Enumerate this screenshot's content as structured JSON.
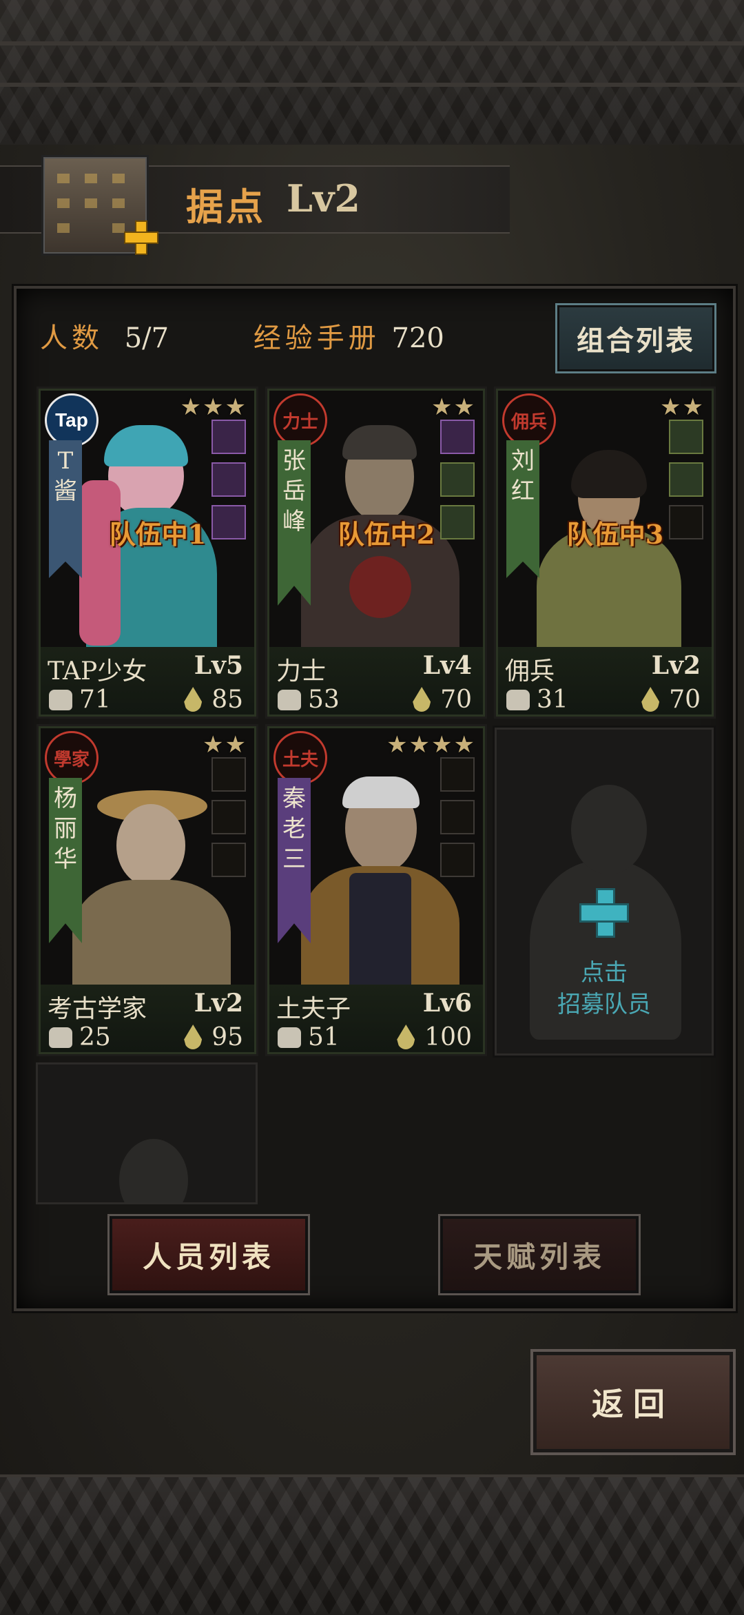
{
  "header": {
    "title": "据点",
    "level": "Lv2"
  },
  "info": {
    "members_label": "人数",
    "members_value": "5/7",
    "exp_label": "经验手册",
    "exp_value": "720"
  },
  "combo_button": "组合列表",
  "cards": [
    {
      "emblem": "Tap",
      "ribbon_name": [
        "T",
        "酱"
      ],
      "stars": "★★★",
      "status": "队伍中1",
      "name": "TAP少女",
      "level": "Lv5",
      "strength": "71",
      "stamina": "85"
    },
    {
      "emblem": "力士",
      "ribbon_name": [
        "张",
        "岳",
        "峰"
      ],
      "stars": "★★",
      "status": "队伍中2",
      "name": "力士",
      "level": "Lv4",
      "strength": "53",
      "stamina": "70"
    },
    {
      "emblem": "佣兵",
      "ribbon_name": [
        "刘",
        "红"
      ],
      "stars": "★★",
      "status": "队伍中3",
      "name": "佣兵",
      "level": "Lv2",
      "strength": "31",
      "stamina": "70"
    },
    {
      "emblem": "學家",
      "ribbon_name": [
        "杨",
        "丽",
        "华"
      ],
      "stars": "★★",
      "status": "",
      "name": "考古学家",
      "level": "Lv2",
      "strength": "25",
      "stamina": "95"
    },
    {
      "emblem": "土夫",
      "ribbon_name": [
        "秦",
        "老",
        "三"
      ],
      "stars": "★★★★",
      "status": "",
      "name": "土夫子",
      "level": "Lv6",
      "strength": "51",
      "stamina": "100"
    }
  ],
  "recruit": {
    "line1": "点击",
    "line2": "招募队员"
  },
  "tabs": {
    "staff": "人员列表",
    "talent": "天赋列表"
  },
  "back_button": "返回",
  "colors": {
    "accent_orange": "#e09a43",
    "teal": "#3fb3c0",
    "panel": "#171614"
  }
}
